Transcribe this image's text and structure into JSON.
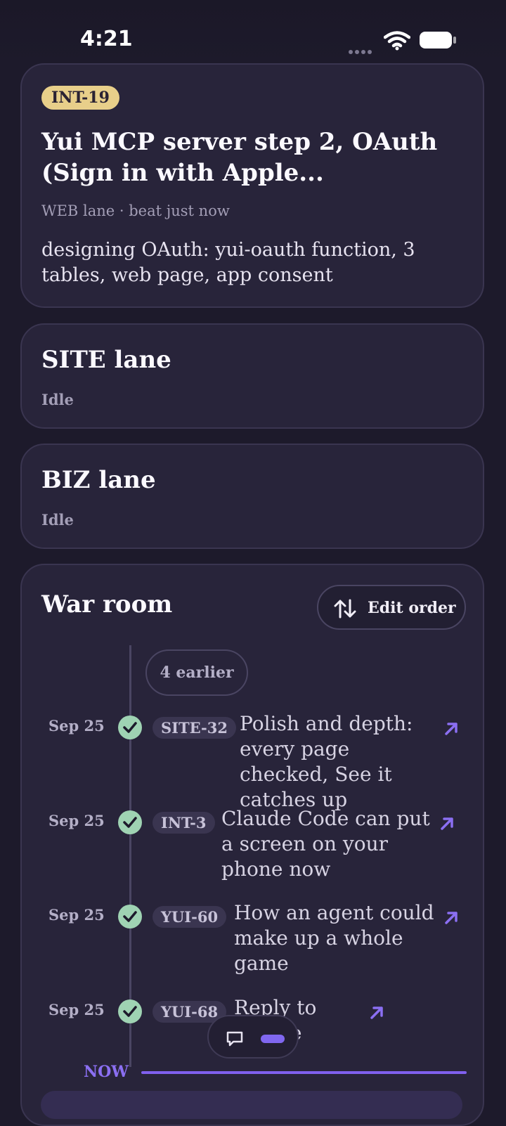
{
  "status_bar": {
    "time": "4:21"
  },
  "current_task": {
    "badge": "INT-19",
    "title": "Yui MCP server step 2, OAuth (Sign in with Apple...",
    "meta": "WEB lane · beat just now",
    "description": "designing OAuth: yui-oauth function, 3 tables, web page, app consent"
  },
  "lanes": [
    {
      "title": "SITE lane",
      "status": "Idle"
    },
    {
      "title": "BIZ lane",
      "status": "Idle"
    }
  ],
  "war_room": {
    "title": "War room",
    "edit_order_label": "Edit order",
    "earlier_label": "4 earlier",
    "items": [
      {
        "date": "Sep 25",
        "tag": "SITE-32",
        "text": "Polish and depth: every page checked, See it catches up"
      },
      {
        "date": "Sep 25",
        "tag": "INT-3",
        "text": "Claude Code can put a screen on your phone now"
      },
      {
        "date": "Sep 25",
        "tag": "YUI-60",
        "text": "How an agent could make up a whole game"
      },
      {
        "date": "Sep 25",
        "tag": "YUI-68",
        "text": "Reply to essage"
      }
    ],
    "now_label": "NOW"
  },
  "colors": {
    "background": "#1d1a2b",
    "card": "#28243a",
    "badge": "#e8cf8a",
    "done_check": "#9fd3b3",
    "accent": "#8b6ff2"
  },
  "icons": {
    "sort": "sort-arrows-icon",
    "check": "check-icon",
    "open": "arrow-up-right-icon",
    "chat": "chat-bubble-icon"
  }
}
